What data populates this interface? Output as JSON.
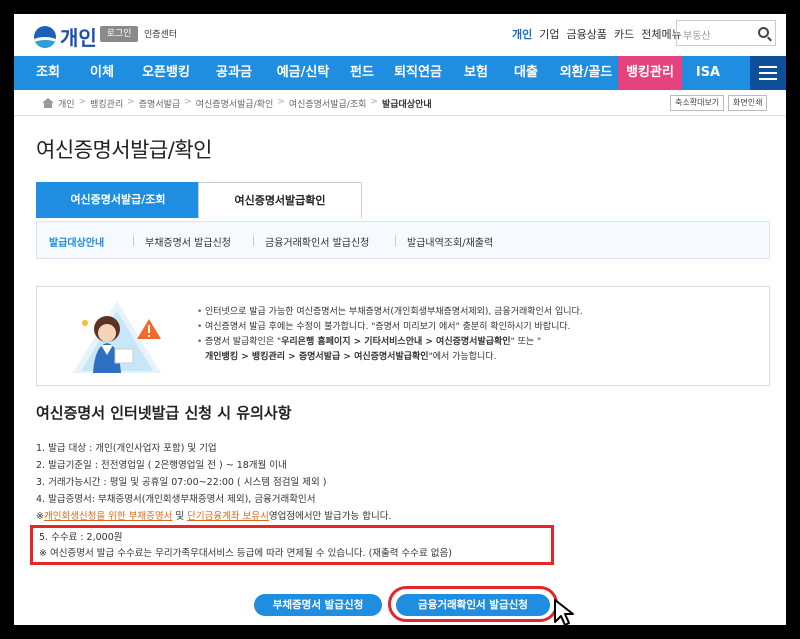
{
  "header": {
    "logo_text": "개인",
    "login_label": "로그인",
    "cert_label": "인증센터",
    "top_links": [
      "개인",
      "기업",
      "금융상품",
      "카드",
      "전체메뉴"
    ],
    "search_placeholder": "부동산"
  },
  "nav": {
    "items": [
      "조회",
      "이체",
      "오픈뱅킹",
      "공과금",
      "예금/신탁",
      "펀드",
      "퇴직연금",
      "보험",
      "대출",
      "외환/골드",
      "뱅킹관리",
      "ISA"
    ],
    "active_index": 10,
    "active_color": "#e6437e",
    "bar_color": "#1f8ee0"
  },
  "breadcrumb": {
    "items": [
      "개인",
      "뱅킹관리",
      "증명서발급",
      "여신증명서발급/확인",
      "여신증명서발급/조회",
      "발급대상안내"
    ],
    "zoom_label": "축소확대보기",
    "print_label": "화면인쇄"
  },
  "page_title": "여신증명서발급/확인",
  "tabs": [
    "여신증명서발급/조회",
    "여신증명서발급확인"
  ],
  "subtabs": [
    "발급대상안내",
    "부채증명서 발급신청",
    "금융거래확인서 발급신청",
    "발급내역조회/재출력"
  ],
  "notice": {
    "line1": "인터넷으로 발급 가능한 여신증명서는 부채증명서(개인회생부채증명서제외), 금융거래확인서 입니다.",
    "line2": "여신증명서 발급 후에는 수정이 불가합니다. \"증명서 미리보기 에서\" 충분히 확인하시기 바랍니다.",
    "line3_a": "증명서 발급확인은 \"",
    "line3_b": "우리은행 홈페이지 > 기타서비스안내 > 여신증명서발급확인",
    "line3_c": "\" 또는 \"",
    "line4_b": "개인뱅킹 > 뱅킹관리 > 증명서발급 > 여신증명서발급확인",
    "line4_c": "\"에서 가능합니다."
  },
  "section_title": "여신증명서 인터넷발급 신청 시 유의사항",
  "rules": {
    "r1": "1. 발급 대상 : 개인(개인사업자 포함) 및 기업",
    "r2": "2. 발급기준일 : 전전영업일 ( 2은행영업일 전 ) ~ 18개월 이내",
    "r3": "3. 거래가능시간 : 평일 및 공휴일 07:00~22:00 ( 시스템 점검일 제외 )",
    "r4": "4. 발급증명서: 부채증명서(개인회생부채증명서 제외), 금융거래확인서",
    "r5_prefix": "※",
    "r5_link1": "개인회생신청을 위한 부채증명서",
    "r5_mid": " 및 ",
    "r5_link2": "단기금융계좌 보유시",
    "r5_suffix": "영업점에서만 발급가능 합니다.",
    "fee": "5. 수수료 : 2,000원",
    "fee_note": "※ 여신증명서 발급 수수료는 우리가족우대서비스 등급에 따라 면제될 수 있습니다. (재출력 수수료 없음)"
  },
  "buttons": {
    "debt_cert": "부채증명서 발급신청",
    "fin_cert": "금융거래확인서 발급신청"
  },
  "highlight_color": "#e5252a"
}
